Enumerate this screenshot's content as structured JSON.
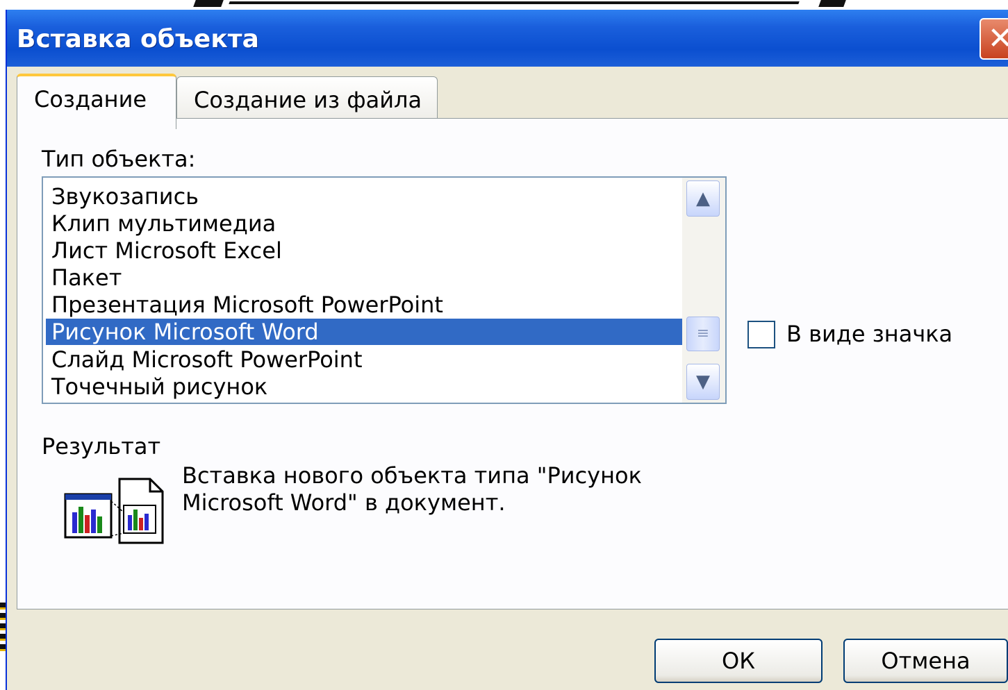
{
  "dialog": {
    "title": "Вставка объекта",
    "close_label": "✕"
  },
  "tabs": [
    {
      "label": "Создание",
      "active": true
    },
    {
      "label": "Создание из файла",
      "active": false
    }
  ],
  "object_type_label": "Тип объекта:",
  "object_types": [
    "Звукозапись",
    "Клип мультимедиа",
    "Лист Microsoft Excel",
    "Пакет",
    "Презентация Microsoft PowerPoint",
    "Рисунок Microsoft Word",
    "Слайд Microsoft PowerPoint",
    "Точечный рисунок"
  ],
  "selected_index": 5,
  "display_as_icon": {
    "label": "В виде значка",
    "checked": false
  },
  "result": {
    "heading": "Результат",
    "line1": "Вставка нового объекта типа \"Рисунок",
    "line2": "Microsoft Word\" в документ."
  },
  "buttons": {
    "ok": "ОК",
    "cancel": "Отмена"
  },
  "icons": {
    "scroll_up": "chevron-up-icon",
    "scroll_down": "chevron-down-icon",
    "scroll_thumb": "grip-icon",
    "result": "embedded-object-icon"
  },
  "colors": {
    "titlebar": "#0b4fd0",
    "selection": "#316ac5",
    "dialog_bg": "#ece9d8",
    "tab_highlight": "#ffc83c"
  }
}
